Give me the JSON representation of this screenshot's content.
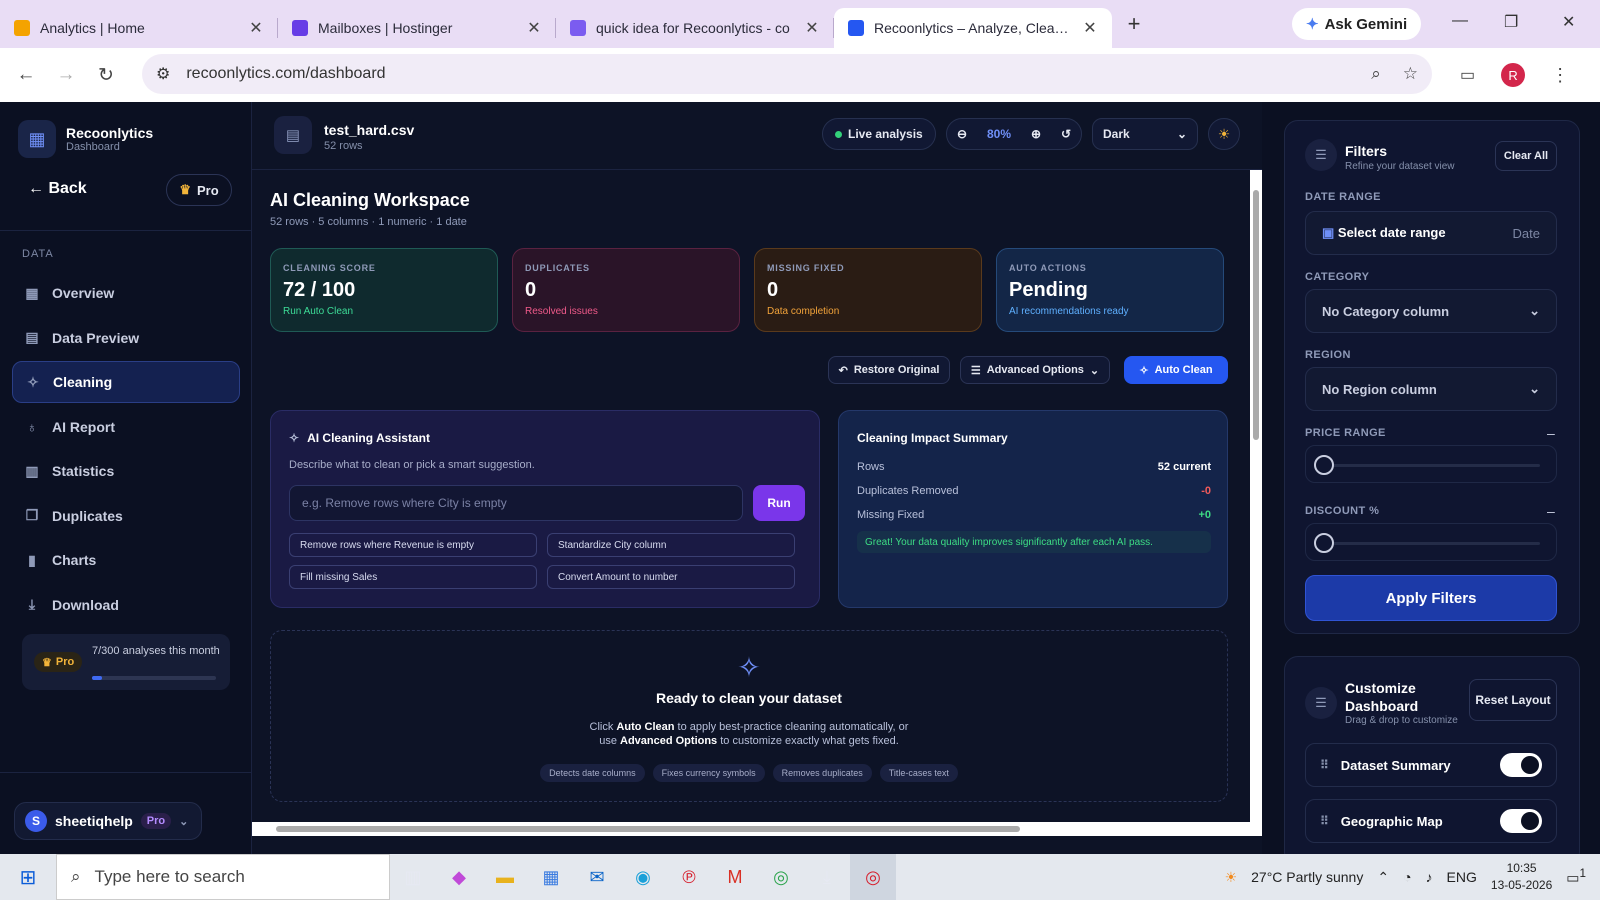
{
  "browser": {
    "tabs": [
      {
        "title": "Analytics | Home",
        "color": "#f4a300"
      },
      {
        "title": "Mailboxes | Hostinger",
        "color": "#673de6"
      },
      {
        "title": "quick idea for Recoonlytics - co",
        "color": "#7b5cf0"
      },
      {
        "title": "Recoonlytics – Analyze, Clean &",
        "color": "#2557f1",
        "active": true
      }
    ],
    "new_tab": "+",
    "gemini": "Ask Gemini",
    "url": "recoonlytics.com/dashboard",
    "profile_initial": "R"
  },
  "sidebar": {
    "brand_name": "Recoonlytics",
    "brand_sub": "Dashboard",
    "back": "Back",
    "pro": "Pro",
    "section": "DATA",
    "items": [
      {
        "label": "Overview",
        "icon": "grid-icon",
        "glyph": "▦"
      },
      {
        "label": "Data Preview",
        "icon": "table-icon",
        "glyph": "▤"
      },
      {
        "label": "Cleaning",
        "icon": "sparkle-icon",
        "glyph": "✧",
        "active": true
      },
      {
        "label": "AI Report",
        "icon": "bulb-icon",
        "glyph": "♁"
      },
      {
        "label": "Statistics",
        "icon": "stats-icon",
        "glyph": "▥"
      },
      {
        "label": "Duplicates",
        "icon": "copy-icon",
        "glyph": "❐"
      },
      {
        "label": "Charts",
        "icon": "bar-chart-icon",
        "glyph": "▮"
      },
      {
        "label": "Download",
        "icon": "download-icon",
        "glyph": "⤓"
      }
    ],
    "usage_badge": "Pro",
    "usage_text": "7/300 analyses this month",
    "usage_fraction": 0.023,
    "user_initial": "S",
    "user_name": "sheetiqhelp",
    "user_plan": "Pro"
  },
  "topbar": {
    "file_name": "test_hard.csv",
    "file_rows": "52 rows",
    "live": "Live analysis",
    "zoom": "80%",
    "theme": "Dark"
  },
  "workspace": {
    "title": "AI Cleaning Workspace",
    "subtitle": "52 rows · 5 columns · 1 numeric · 1 date",
    "cards": [
      {
        "label": "CLEANING SCORE",
        "value": "72 / 100",
        "hint": "Run Auto Clean",
        "bg": "#0f2a2e",
        "border": "#1f5a55",
        "hintColor": "#3ddc97"
      },
      {
        "label": "DUPLICATES",
        "value": "0",
        "hint": "Resolved issues",
        "bg": "#2a1428",
        "border": "#5a2240",
        "hintColor": "#f05a8a"
      },
      {
        "label": "MISSING FIXED",
        "value": "0",
        "hint": "Data completion",
        "bg": "#2a1c14",
        "border": "#5a3a1c",
        "hintColor": "#f2a33a"
      },
      {
        "label": "AUTO ACTIONS",
        "value": "Pending",
        "hint": "AI recommendations ready",
        "bg": "#132647",
        "border": "#254a7a",
        "hintColor": "#5fb0ff"
      }
    ],
    "restore": "Restore Original",
    "advanced": "Advanced Options",
    "auto_clean": "Auto Clean"
  },
  "assistant": {
    "title": "AI Cleaning Assistant",
    "desc": "Describe what to clean or pick a smart suggestion.",
    "placeholder": "e.g. Remove rows where City is empty",
    "run": "Run",
    "chips": [
      "Remove rows where Revenue is empty",
      "Standardize City column",
      "Fill missing Sales",
      "Convert Amount to number"
    ]
  },
  "impact": {
    "title": "Cleaning Impact Summary",
    "rows": [
      {
        "label": "Rows",
        "value": "52 current",
        "color": "#ffffff"
      },
      {
        "label": "Duplicates Removed",
        "value": "-0",
        "color": "#f05a5a"
      },
      {
        "label": "Missing Fixed",
        "value": "+0",
        "color": "#3ddc84"
      }
    ],
    "note": "Great! Your data quality improves significantly after each AI pass."
  },
  "ready": {
    "title": "Ready to clean your dataset",
    "line1_a": "Click ",
    "line1_b": "Auto Clean",
    "line1_c": " to apply best-practice cleaning automatically, or",
    "line2_a": "use ",
    "line2_b": "Advanced Options",
    "line2_c": " to customize exactly what gets fixed.",
    "tags": [
      "Detects date columns",
      "Fixes currency symbols",
      "Removes duplicates",
      "Title-cases text"
    ]
  },
  "filters": {
    "title": "Filters",
    "sub": "Refine your dataset view",
    "clear": "Clear All",
    "date_label": "DATE RANGE",
    "date_value": "Select date range",
    "date_tag": "Date",
    "category_label": "CATEGORY",
    "category_value": "No Category column",
    "region_label": "REGION",
    "region_value": "No Region column",
    "price_label": "PRICE RANGE",
    "discount_label": "DISCOUNT %",
    "collapse": "–",
    "apply": "Apply Filters"
  },
  "customize": {
    "title": "Customize Dashboard",
    "sub": "Drag & drop to customize",
    "reset": "Reset Layout",
    "widgets": [
      {
        "name": "Dataset Summary",
        "on": true
      },
      {
        "name": "Geographic Map",
        "on": true
      }
    ]
  },
  "taskbar": {
    "search": "Type here to search",
    "weather": "27°C  Partly sunny",
    "lang": "ENG",
    "time": "10:35",
    "date": "13-05-2026",
    "notif": "1"
  }
}
